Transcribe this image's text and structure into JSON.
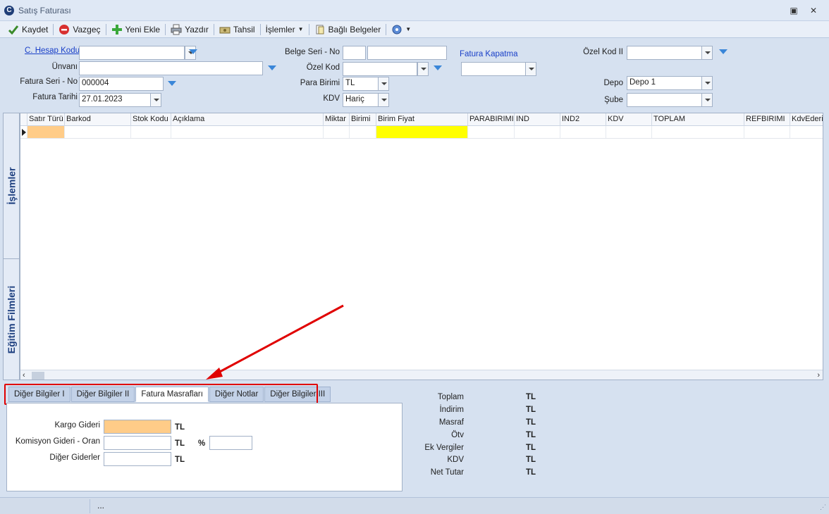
{
  "window": {
    "title": "Satış Faturası"
  },
  "toolbar": {
    "save": "Kaydet",
    "cancel": "Vazgeç",
    "add_new": "Yeni Ekle",
    "print": "Yazdır",
    "collect": "Tahsil",
    "operations": "İşlemler",
    "linked_docs": "Bağlı Belgeler"
  },
  "header_form": {
    "account_code_label": "C. Hesap Kodu",
    "account_code_value": "",
    "title_label": "Ünvanı",
    "title_value": "",
    "invoice_serial_label": "Fatura Seri - No",
    "invoice_serial_value": "000004",
    "invoice_date_label": "Fatura Tarihi",
    "invoice_date_value": "27.01.2023",
    "doc_serial_label": "Belge Seri - No",
    "doc_serial_value": "",
    "doc_no_value": "",
    "special_code_label": "Özel Kod",
    "special_code_value": "",
    "currency_label": "Para Birimi",
    "currency_value": "TL",
    "vat_label": "KDV",
    "vat_value": "Hariç",
    "invoice_closing_label": "Fatura Kapatma",
    "invoice_closing_value": "",
    "special_code2_label": "Özel Kod II",
    "special_code2_value": "",
    "warehouse_label": "Depo",
    "warehouse_value": "Depo 1",
    "branch_label": "Şube",
    "branch_value": ""
  },
  "side_tabs": [
    "İşlemler",
    "Eğitim Filmleri"
  ],
  "grid": {
    "columns": [
      "Satır Türü",
      "Barkod",
      "Stok Kodu",
      "Açıklama",
      "Miktar",
      "Birimi",
      "Birim Fiyat",
      "PARABIRIMI",
      "IND",
      "IND2",
      "KDV",
      "TOPLAM",
      "REFBIRIMI",
      "KdvEderiT"
    ]
  },
  "bottom_tabs": [
    "Diğer Bilgiler I",
    "Diğer Bilgiler II",
    "Fatura Masrafları",
    "Diğer Notlar",
    "Diğer Bilgiler III"
  ],
  "active_tab_index": 2,
  "expenses": {
    "cargo_label": "Kargo Gideri",
    "cargo_value": "",
    "cargo_currency": "TL",
    "commission_label": "Komisyon Gideri - Oran",
    "commission_value": "",
    "commission_currency": "TL",
    "percent_symbol": "%",
    "rate_value": "",
    "other_label": "Diğer Giderler",
    "other_value": "",
    "other_currency": "TL"
  },
  "totals": [
    {
      "label": "Toplam",
      "currency": "TL"
    },
    {
      "label": "İndirim",
      "currency": "TL"
    },
    {
      "label": "Masraf",
      "currency": "TL"
    },
    {
      "label": "Ötv",
      "currency": "TL"
    },
    {
      "label": "Ek Vergiler",
      "currency": "TL"
    },
    {
      "label": "KDV",
      "currency": "TL"
    },
    {
      "label": "Net Tutar",
      "currency": "TL"
    }
  ],
  "statusbar": {
    "text": "..."
  },
  "colors": {
    "accent_highlight": "#e00000",
    "birim_fiyat_cell": "#ffff00",
    "satir_turu_cell": "#ffcc88"
  }
}
